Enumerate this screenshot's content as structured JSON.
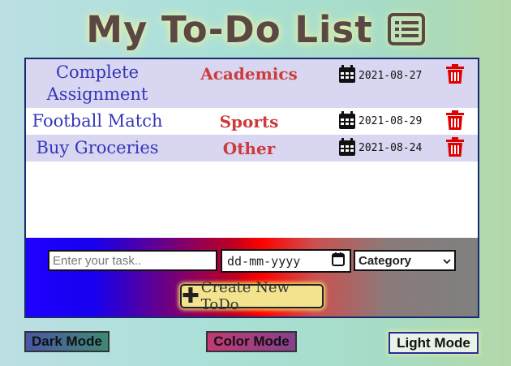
{
  "header": {
    "title": "My To-Do List",
    "icon": "list-icon"
  },
  "todos": [
    {
      "task": "Complete Assignment",
      "category": "Academics",
      "date": "2021-08-27"
    },
    {
      "task": "Football Match",
      "category": "Sports",
      "date": "2021-08-29"
    },
    {
      "task": "Buy Groceries",
      "category": "Other",
      "date": "2021-08-24"
    }
  ],
  "form": {
    "task_placeholder": "Enter your task..",
    "date_placeholder": "dd-mm-yyyy",
    "category_selected": "Category",
    "create_label": "Create New ToDo"
  },
  "modes": {
    "dark": "Dark Mode",
    "color": "Color Mode",
    "light": "Light Mode"
  },
  "colors": {
    "task_text": "#3535b8",
    "category_text": "#cc3b3b",
    "trash": "#e00000",
    "title": "#5b4845"
  }
}
